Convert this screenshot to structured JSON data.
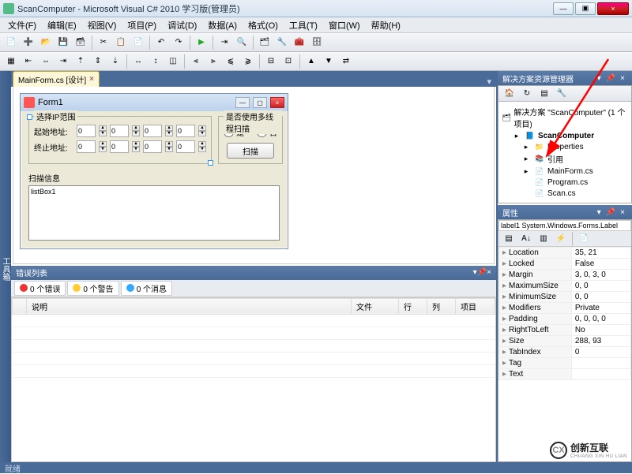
{
  "window": {
    "title": "ScanComputer - Microsoft Visual C# 2010 学习版(管理员)",
    "min": "—",
    "max": "▣",
    "close": "×"
  },
  "menu": [
    "文件(F)",
    "编辑(E)",
    "视图(V)",
    "项目(P)",
    "调试(D)",
    "数据(A)",
    "格式(O)",
    "工具(T)",
    "窗口(W)",
    "帮助(H)"
  ],
  "tab": {
    "label": "MainForm.cs [设计]",
    "close": "×"
  },
  "sidestrip": "工具箱",
  "form": {
    "title": "Form1",
    "group_ip": "选择IP范围",
    "start_label": "起始地址:",
    "end_label": "终止地址:",
    "ip_default": "0",
    "group_thread": "是否使用多线程扫描",
    "radio_yes": "是",
    "radio_no": "否",
    "scan_btn": "扫描",
    "info_label": "扫描信息",
    "listbox": "listBox1"
  },
  "errorlist": {
    "title": "错误列表",
    "btn_err": "0 个错误",
    "btn_warn": "0 个警告",
    "btn_msg": "0 个消息",
    "cols": [
      "",
      "说明",
      "文件",
      "行",
      "列",
      "项目"
    ]
  },
  "solution": {
    "title": "解决方案资源管理器",
    "root": "解决方案 \"ScanComputer\" (1 个项目)",
    "project": "ScanComputer",
    "nodes": {
      "properties": "Properties",
      "references": "引用",
      "mainform": "MainForm.cs",
      "program": "Program.cs",
      "scan": "Scan.cs"
    }
  },
  "properties": {
    "title": "属性",
    "selector": "label1 System.Windows.Forms.Label",
    "rows": [
      {
        "k": "Location",
        "v": "35, 21"
      },
      {
        "k": "Locked",
        "v": "False"
      },
      {
        "k": "Margin",
        "v": "3, 0, 3, 0"
      },
      {
        "k": "MaximumSize",
        "v": "0, 0"
      },
      {
        "k": "MinimumSize",
        "v": "0, 0"
      },
      {
        "k": "Modifiers",
        "v": "Private"
      },
      {
        "k": "Padding",
        "v": "0, 0, 0, 0"
      },
      {
        "k": "RightToLeft",
        "v": "No"
      },
      {
        "k": "Size",
        "v": "288, 93"
      },
      {
        "k": "TabIndex",
        "v": "0"
      },
      {
        "k": "Tag",
        "v": ""
      },
      {
        "k": "Text",
        "v": ""
      }
    ]
  },
  "status": "就绪",
  "watermark": {
    "brand": "创新互联",
    "sub": "CHUANG XIN HU LIAN",
    "logo": "CX"
  }
}
